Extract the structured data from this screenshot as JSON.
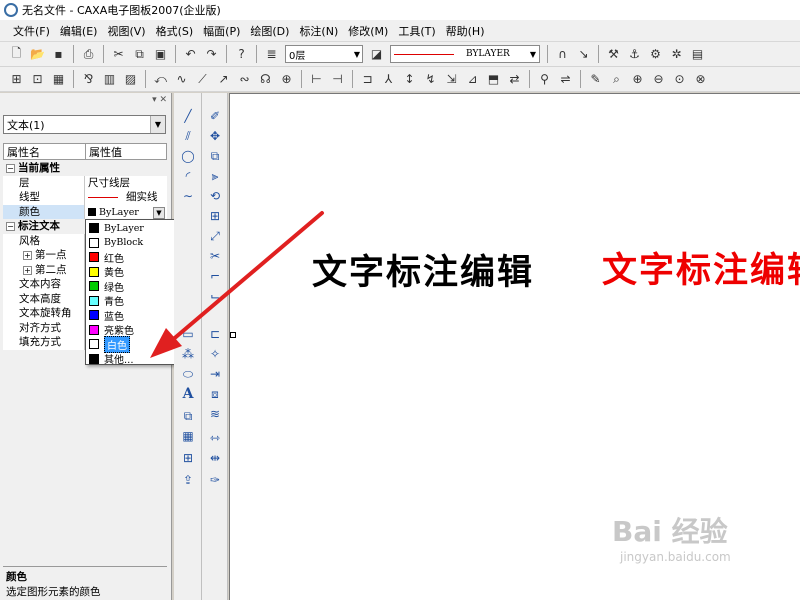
{
  "window": {
    "title": "无名文件 - CAXA电子图板2007(企业版)"
  },
  "menu": [
    "文件(F)",
    "编辑(E)",
    "视图(V)",
    "格式(S)",
    "幅面(P)",
    "绘图(D)",
    "标注(N)",
    "修改(M)",
    "工具(T)",
    "帮助(H)"
  ],
  "toolbar": {
    "layer_value": "0层",
    "linetype_value": "BYLAYER"
  },
  "panel": {
    "object_select": "文本(1)",
    "col_name": "属性名",
    "col_value": "属性值",
    "cat_current": "当前属性",
    "row_layer": {
      "name": "层",
      "value": "尺寸线层"
    },
    "row_linetype": {
      "name": "线型",
      "value": "细实线"
    },
    "row_color": {
      "name": "颜色",
      "value": "ByLayer"
    },
    "cat_text": "标注文本",
    "row_style": {
      "name": "风格"
    },
    "row_p1": {
      "name": "第一点"
    },
    "row_p2": {
      "name": "第二点"
    },
    "row_content": {
      "name": "文本内容"
    },
    "row_height": {
      "name": "文本高度"
    },
    "row_rotate": {
      "name": "文本旋转角"
    },
    "row_align": {
      "name": "对齐方式"
    },
    "row_fill": {
      "name": "填充方式"
    },
    "desc_title": "颜色",
    "desc_text": "选定图形元素的颜色"
  },
  "color_dropdown": [
    {
      "label": "ByLayer",
      "color": "#000000"
    },
    {
      "label": "ByBlock",
      "color": "#ffffff"
    },
    {
      "label": "红色",
      "color": "#ff0000"
    },
    {
      "label": "黄色",
      "color": "#ffff00"
    },
    {
      "label": "绿色",
      "color": "#00cc00"
    },
    {
      "label": "青色",
      "color": "#66ffff"
    },
    {
      "label": "蓝色",
      "color": "#0000ff"
    },
    {
      "label": "亮紫色",
      "color": "#ff00ff"
    },
    {
      "label": "白色",
      "color": "#ffffff",
      "highlighted": true
    },
    {
      "label": "其他...",
      "color": "#000000"
    }
  ],
  "canvas": {
    "text_black": "文字标注编辑",
    "text_red": "文字标注编辑"
  },
  "watermark": {
    "main": "Bai 经验",
    "sub": "jingyan.baidu.com"
  },
  "colors": {
    "annotation_arrow": "#e02020",
    "selection_highlight": "#3399ff",
    "red_text": "#ee0000"
  }
}
